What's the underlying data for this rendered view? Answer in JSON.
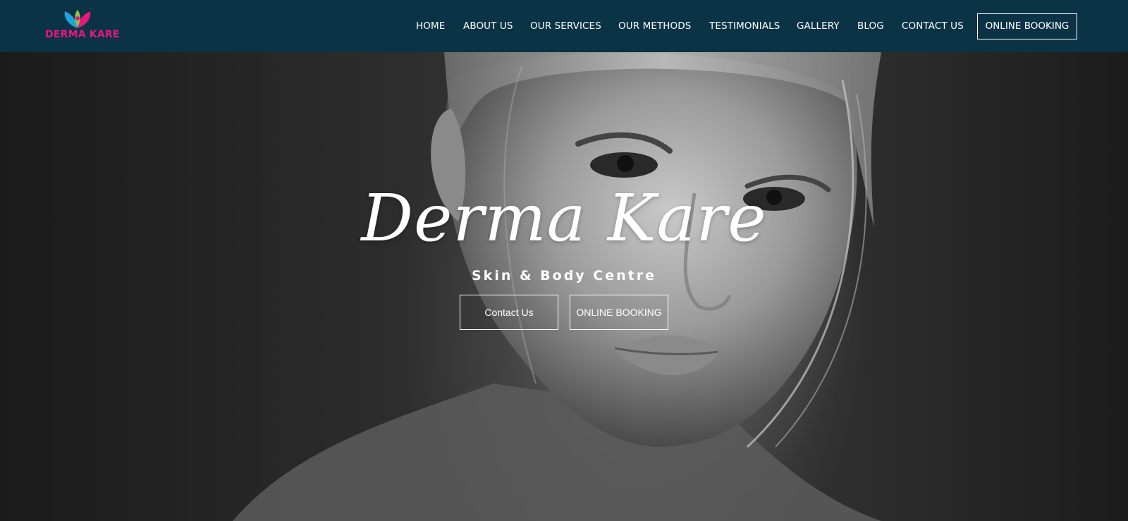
{
  "brand": {
    "logo_text": "DERMA KARE",
    "colors": {
      "pink": "#e8177d",
      "blue": "#1fa3dc",
      "green": "#8cc63f",
      "header_bg": "#0b3346"
    }
  },
  "nav": {
    "items": [
      {
        "label": "HOME"
      },
      {
        "label": "ABOUT US"
      },
      {
        "label": "OUR SERVICES"
      },
      {
        "label": "OUR METHODS"
      },
      {
        "label": "TESTIMONIALS"
      },
      {
        "label": "GALLERY"
      },
      {
        "label": "BLOG"
      },
      {
        "label": "CONTACT US"
      }
    ],
    "booking_label": "ONLINE BOOKING"
  },
  "hero": {
    "title": "Derma Kare",
    "subtitle": "Skin & Body Centre",
    "buttons": {
      "contact_label": "Contact Us",
      "booking_label": "ONLINE BOOKING"
    }
  }
}
